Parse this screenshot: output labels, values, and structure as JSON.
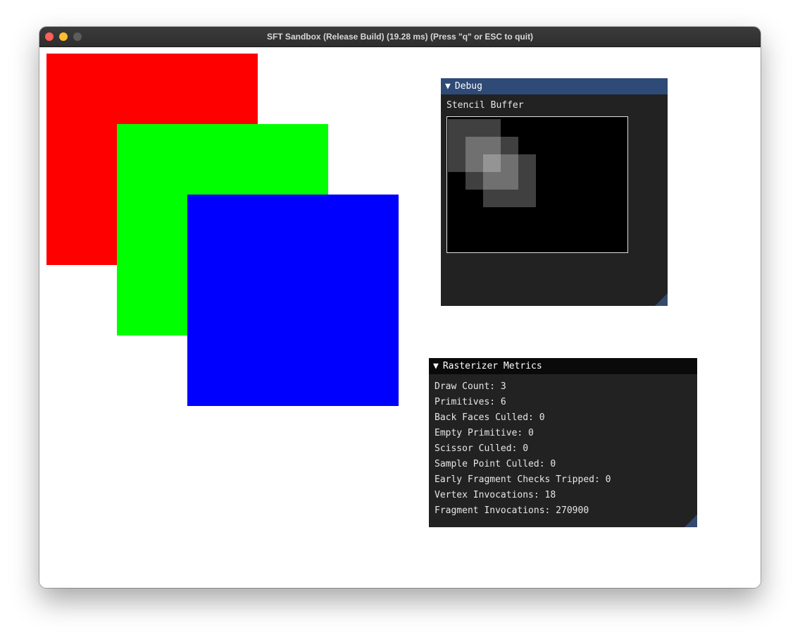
{
  "window": {
    "title": "SFT Sandbox (Release Build) (19.28 ms) (Press \"q\" or ESC to quit)"
  },
  "scene": {
    "quads": [
      {
        "name": "red",
        "color": "#ff0000"
      },
      {
        "name": "green",
        "color": "#00ff00"
      },
      {
        "name": "blue",
        "color": "#0000ff"
      }
    ]
  },
  "debug_panel": {
    "arrow": "▼",
    "title": "Debug",
    "stencil_label": "Stencil Buffer"
  },
  "metrics_panel": {
    "arrow": "▼",
    "title": "Rasterizer Metrics",
    "lines": [
      "Draw Count: 3",
      "Primitives: 6",
      "Back Faces Culled: 0",
      "Empty Primitive: 0",
      "Scissor Culled: 0",
      "Sample Point Culled: 0",
      "Early Fragment Checks Tripped: 0",
      "Vertex Invocations: 18",
      "Fragment Invocations: 270900"
    ]
  },
  "colors": {
    "debug_header": "#2e4a76",
    "metrics_header": "#0a0a0a",
    "panel_bg": "#222222",
    "close": "#fe5f57",
    "minimize": "#febc2e",
    "maximize": "#5c5c5c"
  }
}
